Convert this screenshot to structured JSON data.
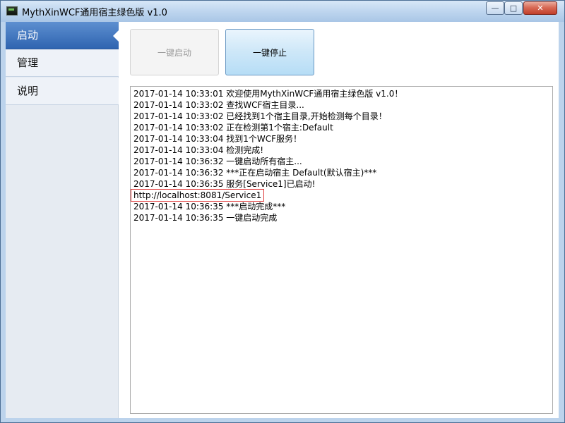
{
  "window": {
    "title": "MythXinWCF通用宿主绿色版 v1.0",
    "controls": {
      "minimize": "—",
      "maximize": "□",
      "close": "✕"
    }
  },
  "sidebar": {
    "items": [
      {
        "label": "启动",
        "active": true
      },
      {
        "label": "管理",
        "active": false
      },
      {
        "label": "说明",
        "active": false
      }
    ]
  },
  "toolbar": {
    "start_all_label": "一键启动",
    "stop_all_label": "一键停止"
  },
  "log": {
    "lines": [
      "2017-01-14 10:33:01 欢迎使用MythXinWCF通用宿主绿色版 v1.0！",
      "2017-01-14 10:33:02 查找WCF宿主目录...",
      "2017-01-14 10:33:02 已经找到1个宿主目录,开始检测每个目录！",
      "2017-01-14 10:33:02 正在检测第1个宿主:Default",
      "2017-01-14 10:33:04 找到1个WCF服务！",
      "2017-01-14 10:33:04 检测完成!",
      "2017-01-14 10:36:32 一键启动所有宿主...",
      "2017-01-14 10:36:32 ***正在启动宿主 Default(默认宿主)***",
      "2017-01-14 10:36:35 服务[Service1]已启动!",
      "http://localhost:8081/Service1",
      "2017-01-14 10:36:35 ***启动完成***",
      "2017-01-14 10:36:35 一键启动完成"
    ]
  },
  "colors": {
    "active_nav": "#3a6fbb",
    "highlight_border": "#e03a3a",
    "stop_button": "#cde7f8"
  }
}
